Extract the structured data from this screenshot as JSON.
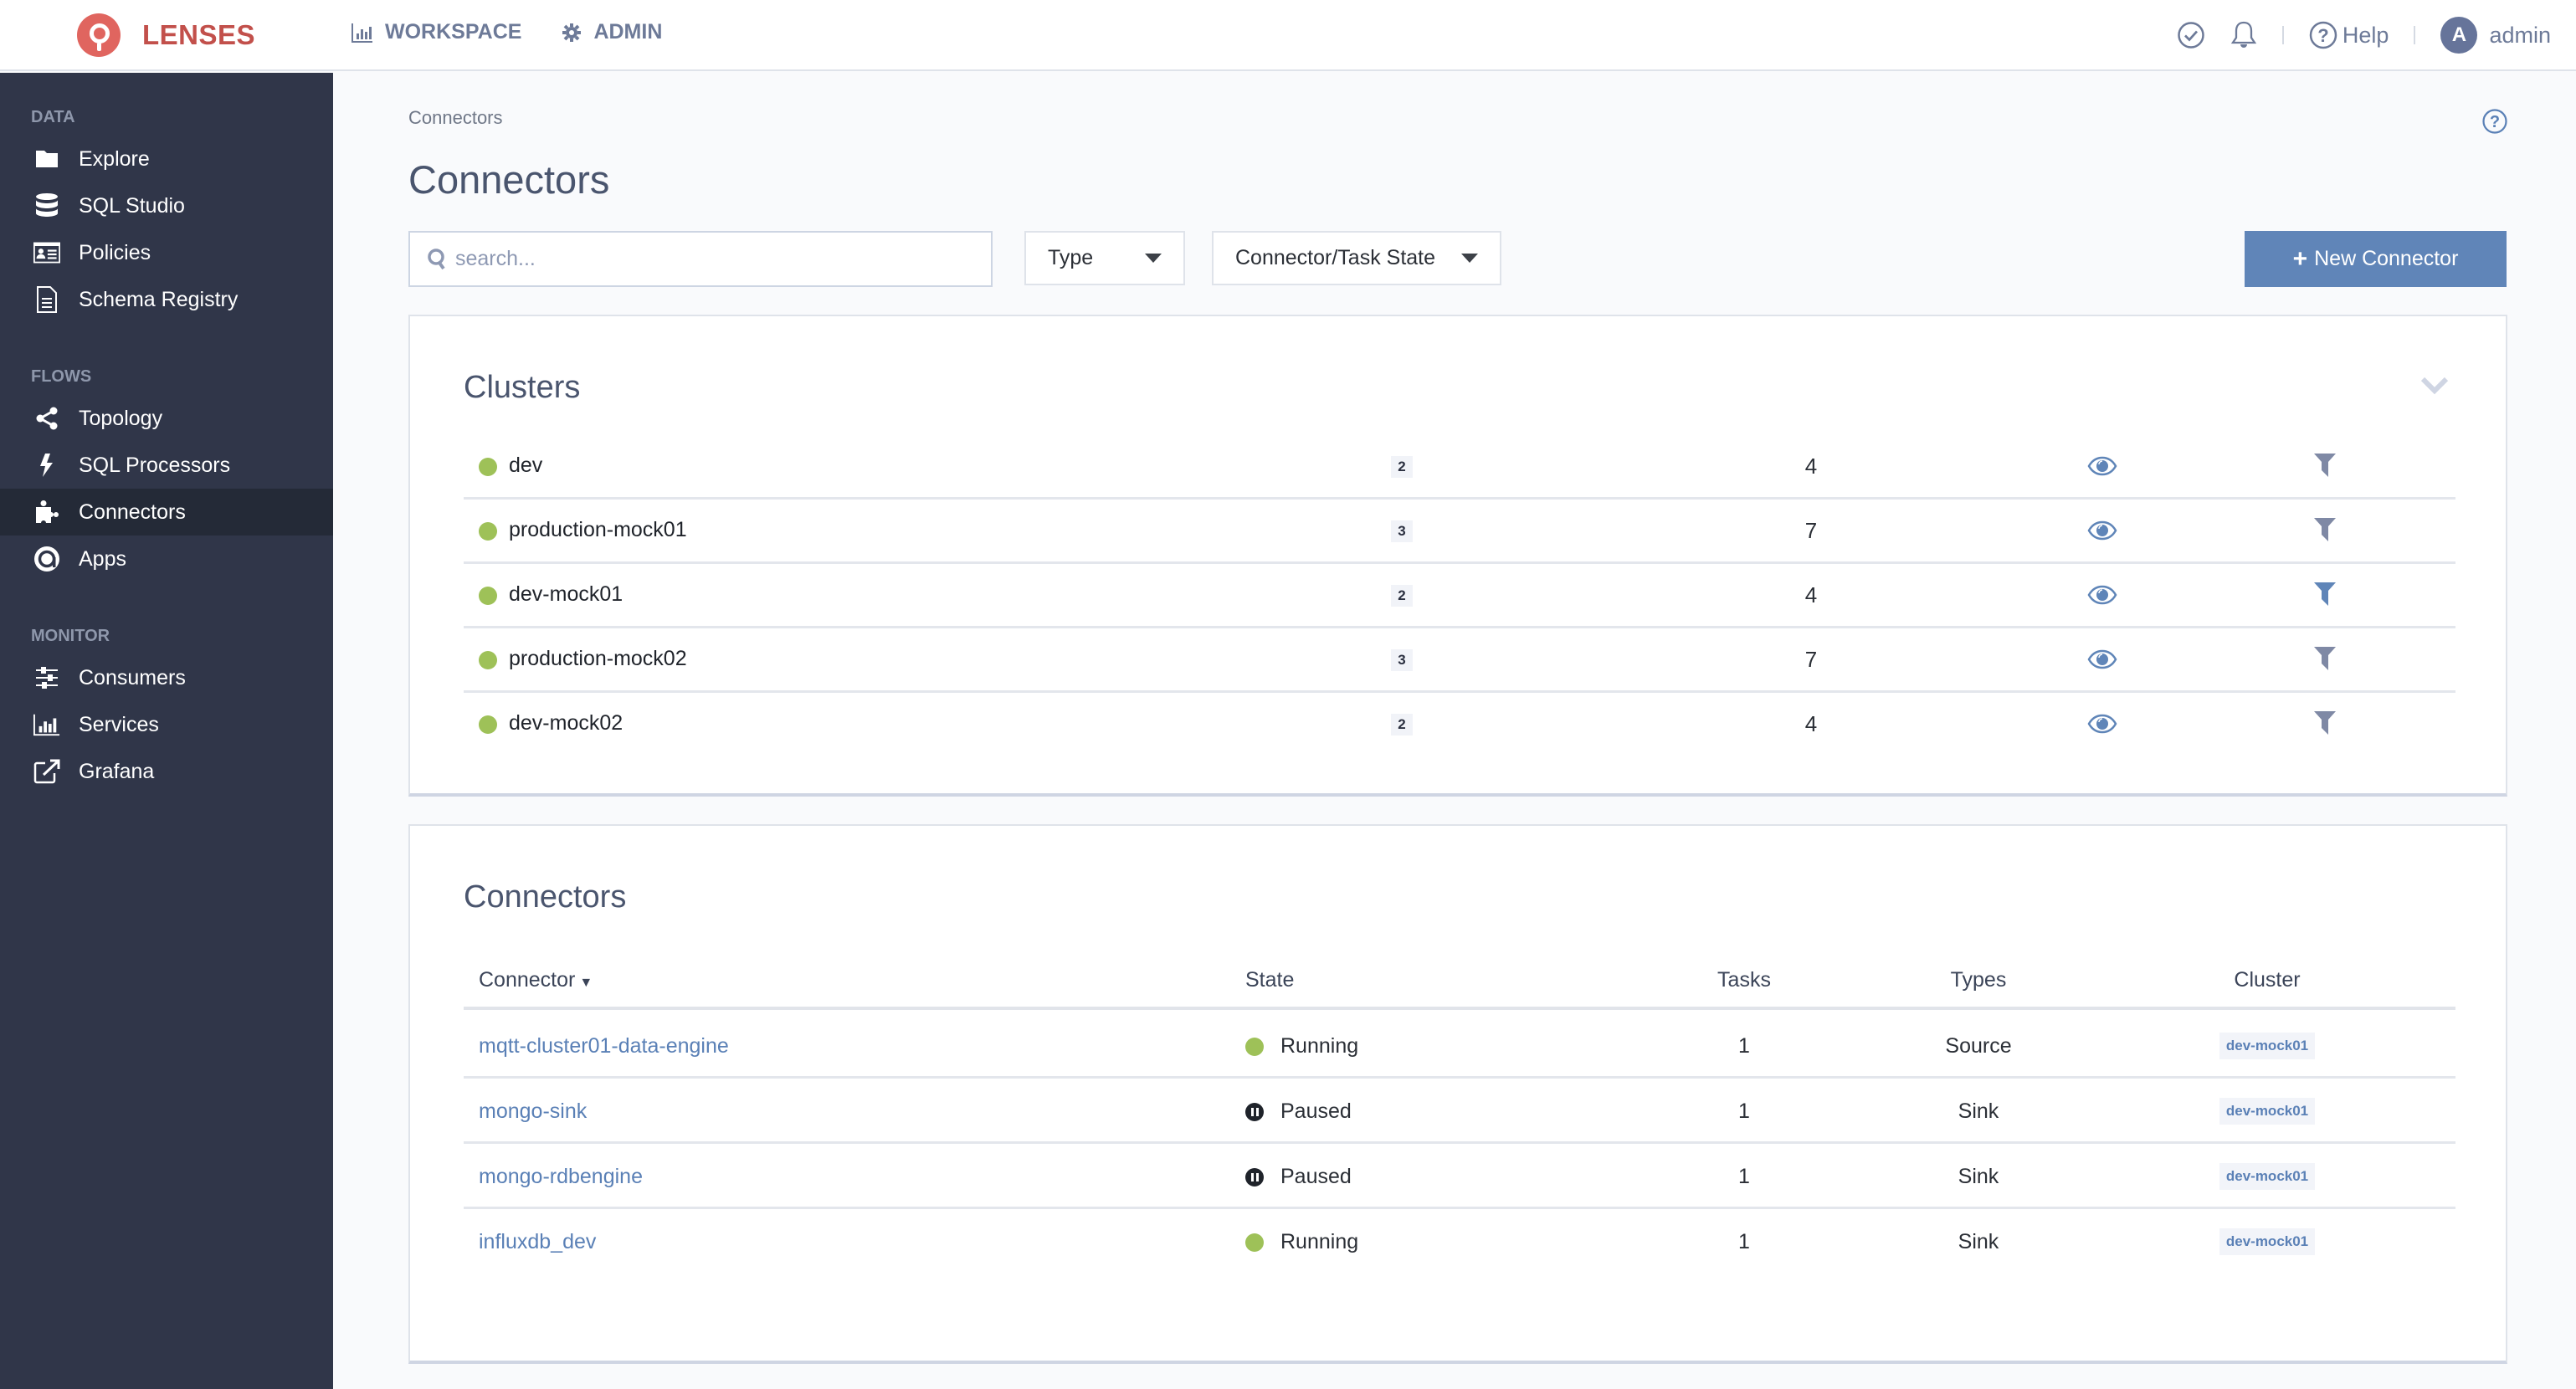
{
  "app": {
    "brand": "LENSES",
    "brand_color": "#e0655f",
    "accent_color": "#6085b8",
    "running_color": "#9ec158"
  },
  "topnav": {
    "items": [
      {
        "label": "WORKSPACE",
        "icon": "bar-chart-icon"
      },
      {
        "label": "ADMIN",
        "icon": "gear-icon"
      }
    ],
    "right": {
      "status_icon": "check-circle-icon",
      "notifications_icon": "bell-icon",
      "help_label": "Help",
      "user_initial": "A",
      "user_name": "admin"
    }
  },
  "sidebar": {
    "sections": [
      {
        "heading": "DATA",
        "items": [
          {
            "label": "Explore",
            "icon": "folder-icon"
          },
          {
            "label": "SQL Studio",
            "icon": "database-icon"
          },
          {
            "label": "Policies",
            "icon": "id-card-icon"
          },
          {
            "label": "Schema Registry",
            "icon": "document-icon"
          }
        ]
      },
      {
        "heading": "FLOWS",
        "items": [
          {
            "label": "Topology",
            "icon": "share-icon"
          },
          {
            "label": "SQL Processors",
            "icon": "bolt-icon"
          },
          {
            "label": "Connectors",
            "icon": "puzzle-icon",
            "active": true
          },
          {
            "label": "Apps",
            "icon": "apps-icon"
          }
        ]
      },
      {
        "heading": "MONITOR",
        "items": [
          {
            "label": "Consumers",
            "icon": "sliders-icon"
          },
          {
            "label": "Services",
            "icon": "bar-chart-icon"
          },
          {
            "label": "Grafana",
            "icon": "external-link-icon"
          }
        ]
      }
    ]
  },
  "page": {
    "breadcrumb": "Connectors",
    "title": "Connectors",
    "search_placeholder": "search...",
    "search_value": "",
    "filters": {
      "type_label": "Type",
      "state_label": "Connector/Task State"
    },
    "new_button_label": "New Connector"
  },
  "clusters": {
    "title": "Clusters",
    "rows": [
      {
        "name": "dev",
        "badge": "2",
        "count": "4",
        "filter_active": false
      },
      {
        "name": "production-mock01",
        "badge": "3",
        "count": "7",
        "filter_active": false
      },
      {
        "name": "dev-mock01",
        "badge": "2",
        "count": "4",
        "filter_active": true
      },
      {
        "name": "production-mock02",
        "badge": "3",
        "count": "7",
        "filter_active": false
      },
      {
        "name": "dev-mock02",
        "badge": "2",
        "count": "4",
        "filter_active": false
      }
    ]
  },
  "connectors": {
    "title": "Connectors",
    "columns": {
      "connector": "Connector",
      "state": "State",
      "tasks": "Tasks",
      "types": "Types",
      "cluster": "Cluster"
    },
    "rows": [
      {
        "name": "mqtt-cluster01-data-engine",
        "state": "Running",
        "tasks": "1",
        "type": "Source",
        "cluster": "dev-mock01"
      },
      {
        "name": "mongo-sink",
        "state": "Paused",
        "tasks": "1",
        "type": "Sink",
        "cluster": "dev-mock01"
      },
      {
        "name": "mongo-rdbengine",
        "state": "Paused",
        "tasks": "1",
        "type": "Sink",
        "cluster": "dev-mock01"
      },
      {
        "name": "influxdb_dev",
        "state": "Running",
        "tasks": "1",
        "type": "Sink",
        "cluster": "dev-mock01"
      }
    ]
  }
}
